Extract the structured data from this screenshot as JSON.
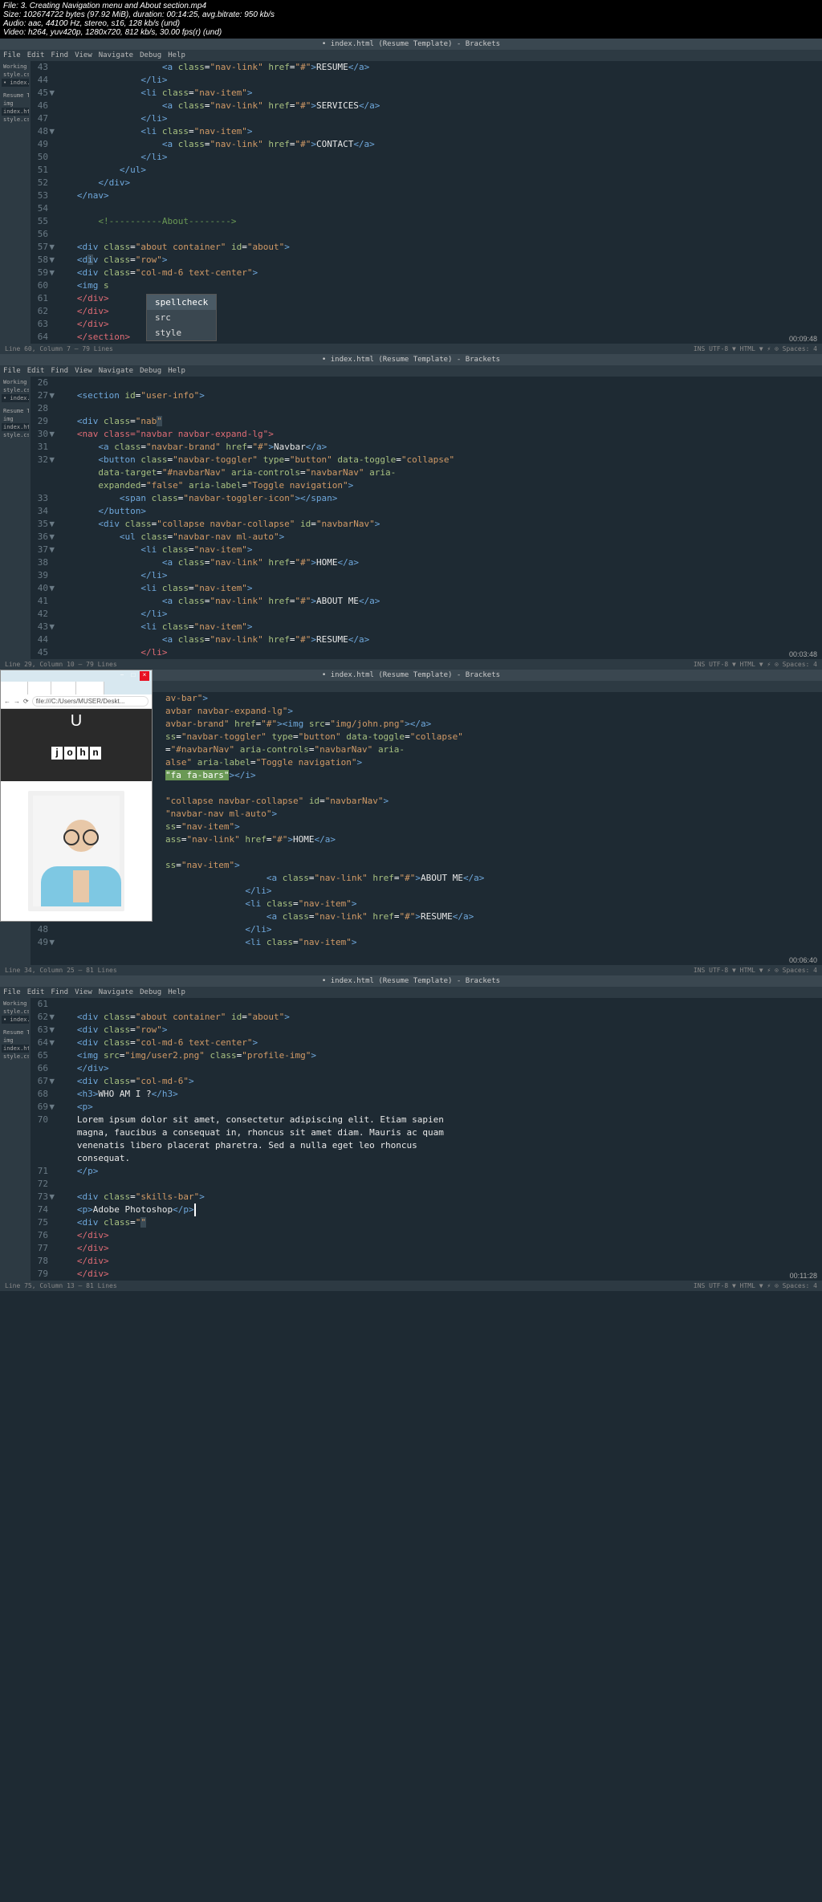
{
  "mediainfo": {
    "file": "File: 3. Creating Navigation menu and About section.mp4",
    "size": "Size: 102674722 bytes (97.92 MiB), duration: 00:14:25, avg.bitrate: 950 kb/s",
    "audio": "Audio: aac, 44100 Hz, stereo, s16, 128 kb/s (und)",
    "video": "Video: h264, yuv420p, 1280x720, 812 kb/s, 30.00 fps(r) (und)"
  },
  "titlebar": "• index.html (Resume Template) - Brackets",
  "menus": [
    "File",
    "Edit",
    "Find",
    "View",
    "Navigate",
    "Debug",
    "Help"
  ],
  "sidebar1": {
    "header": "Working Files",
    "items": [
      "style.css",
      "• index.html"
    ],
    "project": "Resume Templa",
    "pitems": [
      "img",
      "index.html",
      "style.css"
    ]
  },
  "autocomplete": [
    "spellcheck",
    "src",
    "style"
  ],
  "panel1": {
    "start": 43,
    "lines": [
      {
        "n": "43",
        "folds": "",
        "html": "                   <span class='t-tag'>&lt;a</span> <span class='t-attr'>class</span>=<span class='t-str'>\"nav-link\"</span> <span class='t-attr'>href</span>=<span class='t-str'>\"#\"</span><span class='t-tag'>&gt;</span><span class='t-text'>RESUME</span><span class='t-tag'>&lt;/a&gt;</span>"
      },
      {
        "n": "44",
        "html": "               <span class='t-tag'>&lt;/li&gt;</span>"
      },
      {
        "n": "45",
        "fold": "▼",
        "html": "               <span class='t-tag'>&lt;li</span> <span class='t-attr'>class</span>=<span class='t-str'>\"nav-item\"</span><span class='t-tag'>&gt;</span>"
      },
      {
        "n": "46",
        "html": "                   <span class='t-tag'>&lt;a</span> <span class='t-attr'>class</span>=<span class='t-str'>\"nav-link\"</span> <span class='t-attr'>href</span>=<span class='t-str'>\"#\"</span><span class='t-tag'>&gt;</span><span class='t-text'>SERVICES</span><span class='t-tag'>&lt;/a&gt;</span>"
      },
      {
        "n": "47",
        "html": "               <span class='t-tag'>&lt;/li&gt;</span>"
      },
      {
        "n": "48",
        "fold": "▼",
        "html": "               <span class='t-tag'>&lt;li</span> <span class='t-attr'>class</span>=<span class='t-str'>\"nav-item\"</span><span class='t-tag'>&gt;</span>"
      },
      {
        "n": "49",
        "html": "                   <span class='t-tag'>&lt;a</span> <span class='t-attr'>class</span>=<span class='t-str'>\"nav-link\"</span> <span class='t-attr'>href</span>=<span class='t-str'>\"#\"</span><span class='t-tag'>&gt;</span><span class='t-text'>CONTACT</span><span class='t-tag'>&lt;/a&gt;</span>"
      },
      {
        "n": "50",
        "html": "               <span class='t-tag'>&lt;/li&gt;</span>"
      },
      {
        "n": "51",
        "html": "           <span class='t-tag'>&lt;/ul&gt;</span>"
      },
      {
        "n": "52",
        "html": "       <span class='t-tag'>&lt;/div&gt;</span>"
      },
      {
        "n": "53",
        "html": "   <span class='t-tag'>&lt;/nav&gt;</span>"
      },
      {
        "n": "54",
        "html": ""
      },
      {
        "n": "55",
        "html": "       <span class='t-comment'>&lt;!----------About--------&gt;</span>"
      },
      {
        "n": "56",
        "html": ""
      },
      {
        "n": "57",
        "fold": "▼",
        "html": "   <span class='t-tag'>&lt;div</span> <span class='t-attr'>class</span>=<span class='t-str'>\"about container\"</span> <span class='t-attr'>id</span>=<span class='t-str'>\"about\"</span><span class='t-tag'>&gt;</span>"
      },
      {
        "n": "58",
        "fold": "▼",
        "html": "   <span class='t-tag'>&lt;d<span style='background:#3a4a55'>i</span>v</span> <span class='t-attr'>class</span>=<span class='t-str'>\"row\"</span><span class='t-tag'>&gt;</span>"
      },
      {
        "n": "59",
        "fold": "▼",
        "html": "   <span class='t-tag'>&lt;div</span> <span class='t-attr'>class</span>=<span class='t-str'>\"col-md-6 text-center\"</span><span class='t-tag'>&gt;</span>"
      },
      {
        "n": "60",
        "html": "   <span class='t-tag'>&lt;img</span> <span class='t-attr'>s</span>"
      },
      {
        "n": "61",
        "html": "   <span class='t-err'>&lt;/div&gt;</span>"
      },
      {
        "n": "62",
        "html": "   <span class='t-err'>&lt;/div&gt;</span>"
      },
      {
        "n": "63",
        "html": "   <span class='t-err'>&lt;/div&gt;</span>"
      },
      {
        "n": "64",
        "html": "   <span class='t-err'>&lt;/section&gt;</span>"
      }
    ],
    "status_left": "Line 60, Column 7 — 79 Lines",
    "status_right": "INS  UTF-8 ▼  HTML ▼  ⚡  ⊙ Spaces: 4",
    "timestamp": "00:09:48"
  },
  "panel2": {
    "lines": [
      {
        "n": "26",
        "html": ""
      },
      {
        "n": "27",
        "fold": "▼",
        "html": "   <span class='t-tag'>&lt;section</span> <span class='t-attr'>id</span>=<span class='t-str'>\"user-info\"</span><span class='t-tag'>&gt;</span>"
      },
      {
        "n": "28",
        "html": ""
      },
      {
        "n": "29",
        "html": "   <span class='t-tag'>&lt;div</span> <span class='t-attr'>class</span>=<span class='t-str'>\"nab<span style='background:#3a4a55'>\"</span></span>"
      },
      {
        "n": "30",
        "fold": "▼",
        "html": "   <span class='t-err'>&lt;nav class=\"navbar navbar-expand-lg\"&gt;</span>"
      },
      {
        "n": "31",
        "html": "       <span class='t-tag'>&lt;a</span> <span class='t-attr'>class</span>=<span class='t-str'>\"navbar-brand\"</span> <span class='t-attr'>href</span>=<span class='t-str'>\"#\"</span><span class='t-tag'>&gt;</span><span class='t-text'>Navbar</span><span class='t-tag'>&lt;/a&gt;</span>"
      },
      {
        "n": "32",
        "fold": "▼",
        "html": "       <span class='t-tag'>&lt;button</span> <span class='t-attr'>class</span>=<span class='t-str'>\"navbar-toggler\"</span> <span class='t-attr'>type</span>=<span class='t-str'>\"button\"</span> <span class='t-attr'>data-toggle</span>=<span class='t-str'>\"collapse\"</span>"
      },
      {
        "n": "",
        "html": "       <span class='t-attr'>data-target</span>=<span class='t-str'>\"#navbarNav\"</span> <span class='t-attr'>aria-controls</span>=<span class='t-str'>\"navbarNav\"</span> <span class='t-attr'>aria-</span>"
      },
      {
        "n": "",
        "html": "       <span class='t-attr'>expanded</span>=<span class='t-str'>\"false\"</span> <span class='t-attr'>aria-label</span>=<span class='t-str'>\"Toggle navigation\"</span><span class='t-tag'>&gt;</span>"
      },
      {
        "n": "33",
        "html": "           <span class='t-tag'>&lt;span</span> <span class='t-attr'>class</span>=<span class='t-str'>\"navbar-toggler-icon\"</span><span class='t-tag'>&gt;&lt;/span&gt;</span>"
      },
      {
        "n": "34",
        "html": "       <span class='t-tag'>&lt;/button&gt;</span>"
      },
      {
        "n": "35",
        "fold": "▼",
        "html": "       <span class='t-tag'>&lt;div</span> <span class='t-attr'>class</span>=<span class='t-str'>\"collapse navbar-collapse\"</span> <span class='t-attr'>id</span>=<span class='t-str'>\"navbarNav\"</span><span class='t-tag'>&gt;</span>"
      },
      {
        "n": "36",
        "fold": "▼",
        "html": "           <span class='t-tag'>&lt;ul</span> <span class='t-attr'>class</span>=<span class='t-str'>\"navbar-nav ml-auto\"</span><span class='t-tag'>&gt;</span>"
      },
      {
        "n": "37",
        "fold": "▼",
        "html": "               <span class='t-tag'>&lt;li</span> <span class='t-attr'>class</span>=<span class='t-str'>\"nav-item\"</span><span class='t-tag'>&gt;</span>"
      },
      {
        "n": "38",
        "html": "                   <span class='t-tag'>&lt;a</span> <span class='t-attr'>class</span>=<span class='t-str'>\"nav-link\"</span> <span class='t-attr'>href</span>=<span class='t-str'>\"#\"</span><span class='t-tag'>&gt;</span><span class='t-text'>HOME</span><span class='t-tag'>&lt;/a&gt;</span>"
      },
      {
        "n": "39",
        "html": "               <span class='t-tag'>&lt;/li&gt;</span>"
      },
      {
        "n": "40",
        "fold": "▼",
        "html": "               <span class='t-tag'>&lt;li</span> <span class='t-attr'>class</span>=<span class='t-str'>\"nav-item\"</span><span class='t-tag'>&gt;</span>"
      },
      {
        "n": "41",
        "html": "                   <span class='t-tag'>&lt;a</span> <span class='t-attr'>class</span>=<span class='t-str'>\"nav-link\"</span> <span class='t-attr'>href</span>=<span class='t-str'>\"#\"</span><span class='t-tag'>&gt;</span><span class='t-text'>ABOUT ME</span><span class='t-tag'>&lt;/a&gt;</span>"
      },
      {
        "n": "42",
        "html": "               <span class='t-tag'>&lt;/li&gt;</span>"
      },
      {
        "n": "43",
        "fold": "▼",
        "html": "               <span class='t-tag'>&lt;li</span> <span class='t-attr'>class</span>=<span class='t-str'>\"nav-item\"</span><span class='t-tag'>&gt;</span>"
      },
      {
        "n": "44",
        "html": "                   <span class='t-tag'>&lt;a</span> <span class='t-attr'>class</span>=<span class='t-str'>\"nav-link\"</span> <span class='t-attr'>href</span>=<span class='t-str'>\"#\"</span><span class='t-tag'>&gt;</span><span class='t-text'>RESUME</span><span class='t-tag'>&lt;/a&gt;</span>"
      },
      {
        "n": "45",
        "html": "               <span class='t-err'>&lt;/li&gt;</span>"
      }
    ],
    "status_left": "Line 29, Column 10 — 79 Lines",
    "timestamp": "00:03:48"
  },
  "panel3": {
    "lines": [
      {
        "n": "",
        "html": "<span class='t-str'>av-bar\"</span><span class='t-tag'>&gt;</span>"
      },
      {
        "n": "",
        "html": "<span class='t-str'>avbar navbar-expand-lg\"</span><span class='t-tag'>&gt;</span>"
      },
      {
        "n": "",
        "html": "<span class='t-str'>avbar-brand\"</span> <span class='t-attr'>href</span>=<span class='t-str'>\"#\"</span><span class='t-tag'>&gt;&lt;img</span> <span class='t-attr'>src</span>=<span class='t-str'>\"img/john.png\"</span><span class='t-tag'>&gt;&lt;/a&gt;</span>"
      },
      {
        "n": "",
        "html": "<span class='t-attr'>ss</span>=<span class='t-str'>\"navbar-toggler\"</span> <span class='t-attr'>type</span>=<span class='t-str'>\"button\"</span> <span class='t-attr'>data-toggle</span>=<span class='t-str'>\"collapse\"</span>"
      },
      {
        "n": "",
        "html": "=<span class='t-str'>\"#navbarNav\"</span> <span class='t-attr'>aria-controls</span>=<span class='t-str'>\"navbarNav\"</span> <span class='t-attr'>aria-</span>"
      },
      {
        "n": "",
        "html": "<span class='t-str'>alse\"</span> <span class='t-attr'>aria-label</span>=<span class='t-str'>\"Toggle navigation\"</span><span class='t-tag'>&gt;</span>"
      },
      {
        "n": "",
        "html": "<span class='t-hl'>\"fa fa-bars\"</span><span class='t-tag'>&gt;&lt;/i&gt;</span>"
      },
      {
        "n": "",
        "html": ""
      },
      {
        "n": "",
        "html": "<span class='t-str'>\"collapse navbar-collapse\"</span> <span class='t-attr'>id</span>=<span class='t-str'>\"navbarNav\"</span><span class='t-tag'>&gt;</span>"
      },
      {
        "n": "",
        "html": "<span class='t-str'>\"navbar-nav ml-auto\"</span><span class='t-tag'>&gt;</span>"
      },
      {
        "n": "",
        "html": "<span class='t-attr'>ss</span>=<span class='t-str'>\"nav-item\"</span><span class='t-tag'>&gt;</span>"
      },
      {
        "n": "",
        "html": "<span class='t-attr'>ass</span>=<span class='t-str'>\"nav-link\"</span> <span class='t-attr'>href</span>=<span class='t-str'>\"#\"</span><span class='t-tag'>&gt;</span><span class='t-text'>HOME</span><span class='t-tag'>&lt;/a&gt;</span>"
      },
      {
        "n": "",
        "html": ""
      },
      {
        "n": "",
        "html": "<span class='t-attr'>ss</span>=<span class='t-str'>\"nav-item\"</span><span class='t-tag'>&gt;</span>"
      },
      {
        "n": "44",
        "html": "                   <span class='t-tag'>&lt;a</span> <span class='t-attr'>class</span>=<span class='t-str'>\"nav-link\"</span> <span class='t-attr'>href</span>=<span class='t-str'>\"#\"</span><span class='t-tag'>&gt;</span><span class='t-text'>ABOUT ME</span><span class='t-tag'>&lt;/a&gt;</span>"
      },
      {
        "n": "45",
        "html": "               <span class='t-tag'>&lt;/li&gt;</span>"
      },
      {
        "n": "46",
        "fold": "▼",
        "html": "               <span class='t-tag'>&lt;li</span> <span class='t-attr'>class</span>=<span class='t-str'>\"nav-item\"</span><span class='t-tag'>&gt;</span>"
      },
      {
        "n": "47",
        "html": "                   <span class='t-tag'>&lt;a</span> <span class='t-attr'>class</span>=<span class='t-str'>\"nav-link\"</span> <span class='t-attr'>href</span>=<span class='t-str'>\"#\"</span><span class='t-tag'>&gt;</span><span class='t-text'>RESUME</span><span class='t-tag'>&lt;/a&gt;</span>"
      },
      {
        "n": "48",
        "html": "               <span class='t-tag'>&lt;/li&gt;</span>"
      },
      {
        "n": "49",
        "fold": "▼",
        "html": "               <span class='t-tag'>&lt;li</span> <span class='t-attr'>class</span>=<span class='t-str'>\"nav-item\"</span><span class='t-tag'>&gt;</span>"
      }
    ],
    "status_left": "Line 34, Column 25 — 81 Lines",
    "timestamp": "00:06:40",
    "browser_url": "file:///C:/Users/MUSER/Deskt...",
    "john": "john"
  },
  "panel4": {
    "lines": [
      {
        "n": "61",
        "html": ""
      },
      {
        "n": "62",
        "fold": "▼",
        "html": "   <span class='t-tag'>&lt;div</span> <span class='t-attr'>class</span>=<span class='t-str'>\"about container\"</span> <span class='t-attr'>id</span>=<span class='t-str'>\"about\"</span><span class='t-tag'>&gt;</span>"
      },
      {
        "n": "63",
        "fold": "▼",
        "html": "   <span class='t-tag'>&lt;div</span> <span class='t-attr'>class</span>=<span class='t-str'>\"row\"</span><span class='t-tag'>&gt;</span>"
      },
      {
        "n": "64",
        "fold": "▼",
        "html": "   <span class='t-tag'>&lt;div</span> <span class='t-attr'>class</span>=<span class='t-str'>\"col-md-6 text-center\"</span><span class='t-tag'>&gt;</span>"
      },
      {
        "n": "65",
        "html": "   <span class='t-tag'>&lt;img</span> <span class='t-attr'>src</span>=<span class='t-str'>\"img/user2.png\"</span> <span class='t-attr'>class</span>=<span class='t-str'>\"profile-img\"</span><span class='t-tag'>&gt;</span>"
      },
      {
        "n": "66",
        "html": "   <span class='t-tag'>&lt;/div&gt;</span>"
      },
      {
        "n": "67",
        "fold": "▼",
        "html": "   <span class='t-tag'>&lt;div</span> <span class='t-attr'>class</span>=<span class='t-str'>\"col-md-6\"</span><span class='t-tag'>&gt;</span>"
      },
      {
        "n": "68",
        "html": "   <span class='t-tag'>&lt;h3&gt;</span><span class='t-text'>WHO AM I ?</span><span class='t-tag'>&lt;/h3&gt;</span>"
      },
      {
        "n": "69",
        "fold": "▼",
        "html": "   <span class='t-tag'>&lt;p&gt;</span>"
      },
      {
        "n": "70",
        "html": "   <span class='t-text'>Lorem ipsum dolor sit amet, consectetur adipiscing elit. Etiam sapien</span>"
      },
      {
        "n": "",
        "html": "   <span class='t-text'>magna, faucibus a consequat in, rhoncus sit amet diam. Mauris ac quam</span>"
      },
      {
        "n": "",
        "html": "   <span class='t-text'>venenatis libero placerat pharetra. Sed a nulla eget leo rhoncus</span>"
      },
      {
        "n": "",
        "html": "   <span class='t-text'>consequat.</span>"
      },
      {
        "n": "71",
        "html": "   <span class='t-tag'>&lt;/p&gt;</span>"
      },
      {
        "n": "72",
        "html": ""
      },
      {
        "n": "73",
        "fold": "▼",
        "html": "   <span class='t-tag'>&lt;div</span> <span class='t-attr'>class</span>=<span class='t-str'>\"skills-bar\"</span><span class='t-tag'>&gt;</span>"
      },
      {
        "n": "74",
        "html": "   <span class='t-tag'>&lt;p&gt;</span><span class='t-text'>Adobe Photoshop</span><span class='t-tag'>&lt;/p&gt;</span><span style='background:#fff;width:2px;display:inline-block;'>&nbsp;</span>"
      },
      {
        "n": "75",
        "html": "   <span class='t-tag'>&lt;div</span> <span class='t-attr'>class</span>=<span class='t-str'>\"<span style='background:#3a4a55'>\"</span></span>"
      },
      {
        "n": "76",
        "html": "   <span class='t-err'>&lt;/div&gt;</span>"
      },
      {
        "n": "77",
        "html": "   <span class='t-err'>&lt;/div&gt;</span>"
      },
      {
        "n": "78",
        "html": "   <span class='t-err'>&lt;/div&gt;</span>"
      },
      {
        "n": "79",
        "html": "   <span class='t-err'>&lt;/div&gt;</span>"
      }
    ],
    "status_left": "Line 75, Column 13 — 81 Lines",
    "timestamp": "00:11:28"
  }
}
